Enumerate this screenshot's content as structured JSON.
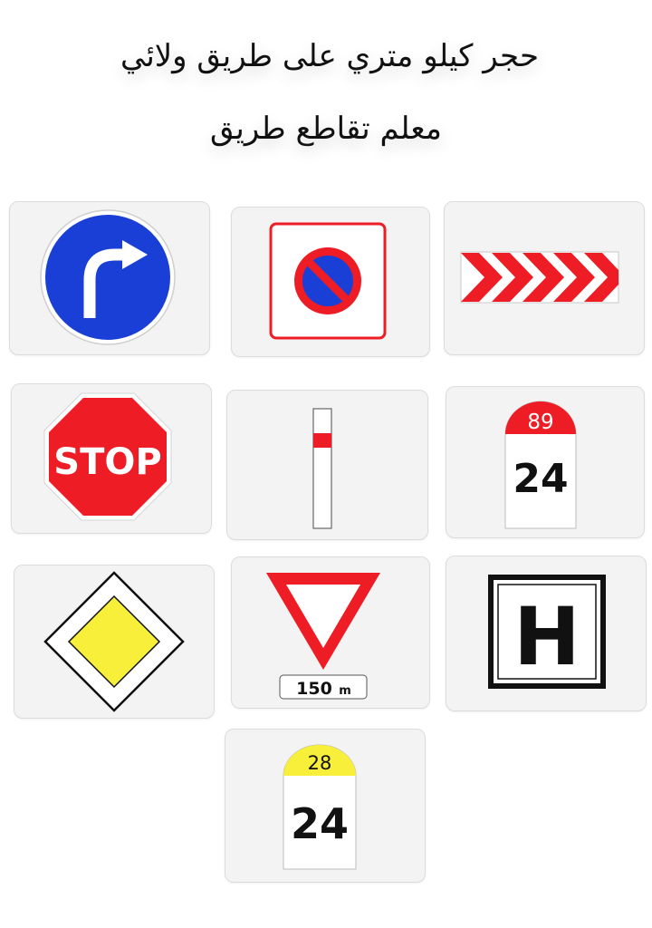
{
  "header": {
    "line1": "حجر كيلو متري على طريق ولائي",
    "line2": "معلم تقاطع طريق"
  },
  "signs": [
    {
      "name": "turn-right-mandatory-sign"
    },
    {
      "name": "no-parking-zone-sign"
    },
    {
      "name": "chevron-bend-marker-sign"
    },
    {
      "name": "stop-sign",
      "text": "STOP"
    },
    {
      "name": "delineator-post-sign"
    },
    {
      "name": "kilometer-marker-red-sign",
      "road": "89",
      "km": "24"
    },
    {
      "name": "priority-road-sign"
    },
    {
      "name": "give-way-distance-sign",
      "distance": "150",
      "unit": "m"
    },
    {
      "name": "hospital-sign",
      "text": "H"
    },
    {
      "name": "kilometer-marker-yellow-sign",
      "road": "28",
      "km": "24"
    }
  ],
  "colors": {
    "blue": "#1a3fd6",
    "red": "#ee1c25",
    "yellow": "#f7ef3a",
    "card_bg": "#f3f3f3"
  }
}
